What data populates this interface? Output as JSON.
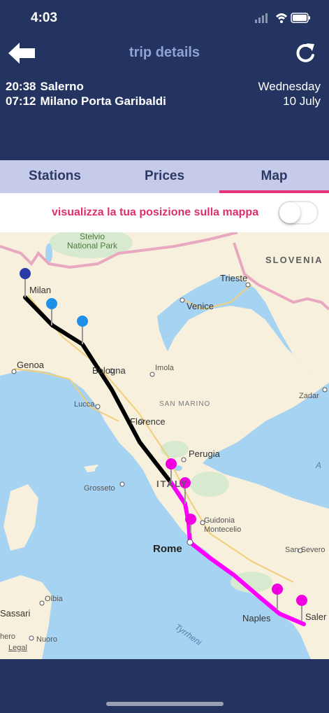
{
  "status": {
    "time": "4:03"
  },
  "nav": {
    "title": "trip details"
  },
  "trip": {
    "departure": {
      "time": "20:38",
      "station": "Salerno"
    },
    "arrival": {
      "time": "07:12",
      "station": "Milano Porta Garibaldi"
    },
    "day": "Wednesday",
    "date": "10 July"
  },
  "tabs": [
    {
      "label": "Stations"
    },
    {
      "label": "Prices"
    },
    {
      "label": "Map"
    }
  ],
  "location": {
    "label": "visualizza la tua posizione sulla mappa",
    "enabled": false
  },
  "map": {
    "park": "Stelvio\nNational Park",
    "countries": {
      "slovenia": "SLOVENIA",
      "italy": "ITALY",
      "san_marino": "SAN MARINO"
    },
    "cities": {
      "milan": "Milan",
      "trieste": "Trieste",
      "venice": "Venice",
      "genoa": "Genoa",
      "bologna": "Bologna",
      "imola": "Imola",
      "zadar": "Zadar",
      "lucca": "Lucca",
      "florence": "Florence",
      "perugia": "Perugia",
      "grosseto": "Grosseto",
      "guidonia": "Guidonia\nMontecelio",
      "rome": "Rome",
      "san_severo": "San Severo",
      "olbia": "Olbia",
      "sassari": "Sassari",
      "naples": "Naples",
      "salerno": "Saler",
      "oristano": "hero",
      "nuoro": "Nuoro"
    },
    "sea": {
      "tyrrhenian": "Tyrrheni",
      "adriatic": "A"
    },
    "legal": "Legal",
    "colors": {
      "route_north": "#000000",
      "route_south": "#ff00ff",
      "pin_blue": "#1e90e8",
      "pin_navy": "#2a3aa8",
      "pin_magenta": "#f000e0"
    }
  }
}
